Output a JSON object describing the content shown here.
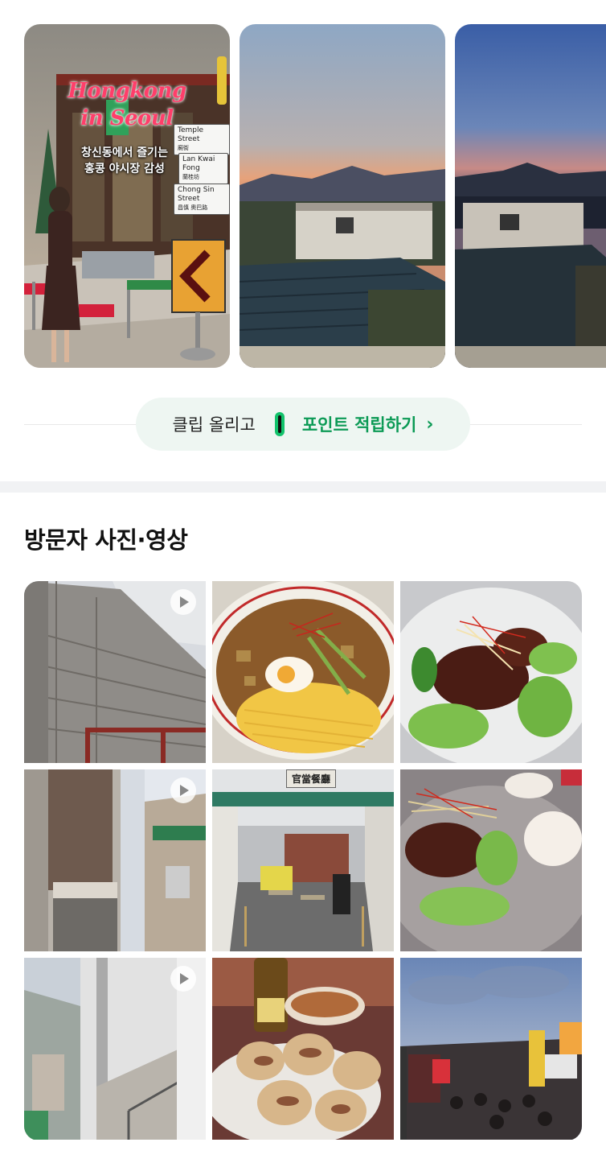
{
  "clips": {
    "items": [
      {
        "overlay_title_line1": "Hongkong",
        "overlay_title_line2": "in Seoul",
        "overlay_sub_line1": "창신동에서 즐기는",
        "overlay_sub_line2": "홍콩 야시장 감성",
        "signs": [
          {
            "en": "Temple Street",
            "zh": "廟街"
          },
          {
            "en": "Lan Kwai Fong",
            "zh": "蘭桂坊"
          },
          {
            "en": "Chong Sin Street",
            "zh": "昌慎 奧巴路"
          }
        ]
      },
      {
        "description": "sunset-rooftop"
      },
      {
        "description": "dusk-rooftop"
      }
    ]
  },
  "cta": {
    "prefix": "클립 올리고",
    "icon": "clip-icon",
    "highlight": "포인트 적립하기",
    "chevron": "›"
  },
  "visitor_section": {
    "title": "방문자 사진·영상"
  },
  "media_grid": {
    "tiles": [
      {
        "type": "video",
        "icon": "play-icon"
      },
      {
        "type": "photo"
      },
      {
        "type": "photo"
      },
      {
        "type": "video",
        "icon": "play-icon"
      },
      {
        "type": "photo",
        "sign_text": "官當餐廳"
      },
      {
        "type": "photo"
      },
      {
        "type": "video",
        "icon": "play-icon"
      },
      {
        "type": "photo"
      },
      {
        "type": "photo"
      }
    ]
  },
  "colors": {
    "accent_green": "#0b9a55",
    "cta_bg": "#eef6f2",
    "divider": "#f1f2f4",
    "title_pink": "#ff3e6a"
  }
}
